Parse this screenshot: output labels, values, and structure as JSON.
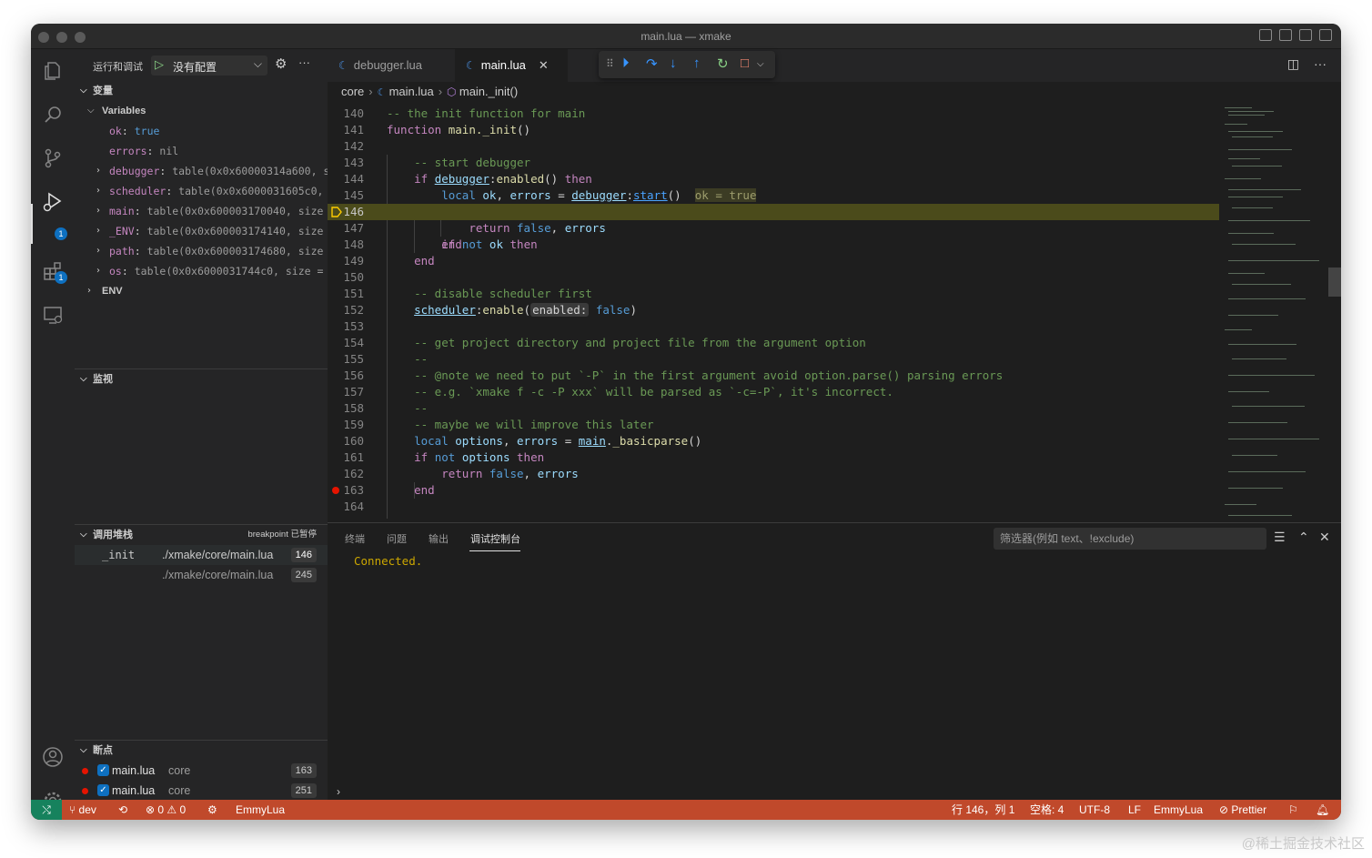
{
  "window": {
    "title": "main.lua — xmake"
  },
  "sidebar": {
    "title": "运行和调试",
    "config": "没有配置",
    "sections": {
      "variables": "变量",
      "watch": "监视",
      "callstack": "调用堆栈",
      "callstack_status": "breakpoint 已暂停",
      "breakpoints": "断点"
    },
    "variables": {
      "group": "Variables",
      "rows": [
        {
          "name": "ok",
          "value": "true"
        },
        {
          "name": "errors",
          "value": "nil"
        },
        {
          "name": "debugger",
          "value": "table(0x0x60000314a600, s…"
        },
        {
          "name": "scheduler",
          "value": "table(0x0x6000031605c0, …"
        },
        {
          "name": "main",
          "value": "table(0x0x600003170040, size …"
        },
        {
          "name": "_ENV",
          "value": "table(0x0x600003174140, size …"
        },
        {
          "name": "path",
          "value": "table(0x0x600003174680, size …"
        },
        {
          "name": "os",
          "value": "table(0x0x6000031744c0, size = …"
        }
      ],
      "env_group": "ENV"
    },
    "callstack": [
      {
        "fn": "_init",
        "file": "./xmake/core/main.lua",
        "line": "146"
      },
      {
        "fn": "",
        "file": "./xmake/core/main.lua",
        "line": "245"
      }
    ],
    "breakpoints": [
      {
        "file": "main.lua",
        "dir": "core",
        "line": "163"
      },
      {
        "file": "main.lua",
        "dir": "core",
        "line": "251"
      }
    ]
  },
  "activity_badges": {
    "debug": "1",
    "extensions": "1"
  },
  "tabs": [
    {
      "label": "debugger.lua",
      "active": false
    },
    {
      "label": "main.lua",
      "active": true
    }
  ],
  "breadcrumb": {
    "folder": "core",
    "file": "main.lua",
    "symbol": "main._init()"
  },
  "code": {
    "current_line": 146,
    "lines": [
      {
        "n": "140",
        "text": "-- the init function for main"
      },
      {
        "n": "141",
        "text": "function main._init()"
      },
      {
        "n": "142",
        "text": ""
      },
      {
        "n": "143",
        "text": "    -- start debugger"
      },
      {
        "n": "144",
        "text": "    if debugger:enabled() then"
      },
      {
        "n": "145",
        "text": "        local ok, errors = debugger:start()  ok = true"
      },
      {
        "n": "146",
        "text": "        if not ok then"
      },
      {
        "n": "147",
        "text": "            return false, errors"
      },
      {
        "n": "148",
        "text": "        end"
      },
      {
        "n": "149",
        "text": "    end"
      },
      {
        "n": "150",
        "text": ""
      },
      {
        "n": "151",
        "text": "    -- disable scheduler first"
      },
      {
        "n": "152",
        "text": "    scheduler:enable(enabled: false)"
      },
      {
        "n": "153",
        "text": ""
      },
      {
        "n": "154",
        "text": "    -- get project directory and project file from the argument option"
      },
      {
        "n": "155",
        "text": "    --"
      },
      {
        "n": "156",
        "text": "    -- @note we need to put `-P` in the first argument avoid option.parse() parsing errors"
      },
      {
        "n": "157",
        "text": "    -- e.g. `xmake f -c -P xxx` will be parsed as `-c=-P`, it's incorrect."
      },
      {
        "n": "158",
        "text": "    --"
      },
      {
        "n": "159",
        "text": "    -- maybe we will improve this later"
      },
      {
        "n": "160",
        "text": "    local options, errors = main._basicparse()"
      },
      {
        "n": "161",
        "text": "    if not options then"
      },
      {
        "n": "162",
        "text": "        return false, errors"
      },
      {
        "n": "163",
        "text": "    end"
      },
      {
        "n": "164",
        "text": ""
      }
    ]
  },
  "panel": {
    "tabs": [
      "终端",
      "问题",
      "输出",
      "调试控制台"
    ],
    "active_tab": "调试控制台",
    "filter_placeholder": "筛选器(例如 text、!exclude)",
    "output": "Connected."
  },
  "statusbar": {
    "branch": "dev",
    "errors": "0",
    "warnings": "0",
    "debug_target": "EmmyLua",
    "position": "行 146，列 1",
    "spaces": "空格: 4",
    "encoding": "UTF-8",
    "eol": "LF",
    "language": "EmmyLua",
    "formatter": "Prettier"
  },
  "colors": {
    "statusbar": "#c0492b",
    "accent": "#0e70c0",
    "current_line": "#4b4b1b",
    "breakpoint": "#e51400"
  },
  "watermark": "@稀土掘金技术社区"
}
